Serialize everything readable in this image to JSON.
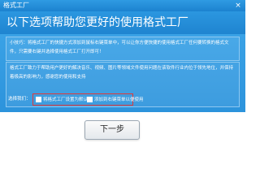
{
  "window": {
    "title": "格式工厂",
    "close_glyph": "×"
  },
  "header": {
    "heading": "以下选项帮助您更好的使用格式工厂"
  },
  "intro": {
    "text": "小技巧：将格式工厂的快捷方式添加到鼠标右键菜单中，可以让你方便快捷的使用格式工厂任何要转换的格式文件，只需要右键并选择使用格式工厂打开即可！"
  },
  "description": {
    "text": "格式工厂致力于帮助用户更好的解决音乐、视频、图片等领域文件使用问题在该软件行业内位于领先地位，并保持着极高的影响力，感谢您的使用和支持"
  },
  "choices": {
    "label": "选择我们：",
    "options": [
      {
        "label": "将格式工厂设置为默认",
        "checked": false
      },
      {
        "label": "添加到右键菜单以便使用",
        "checked": false
      }
    ],
    "highlight_color": "#e03a3a"
  },
  "footer": {
    "next_label": "下一步"
  },
  "colors": {
    "title_bar": "#1c82cf",
    "panel": "#2c93dc",
    "button_bg": "#eef1f4"
  }
}
